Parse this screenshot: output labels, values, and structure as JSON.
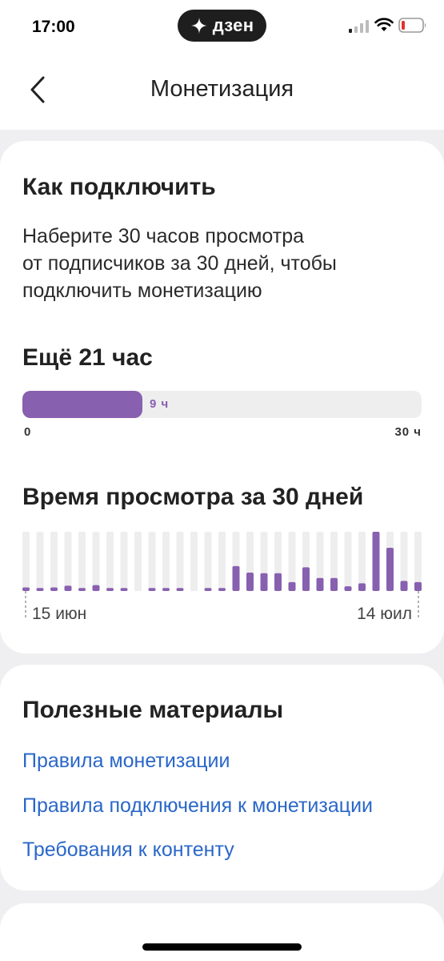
{
  "status_bar": {
    "time": "17:00",
    "brand": "дзен",
    "battery_color": "#e5332a"
  },
  "header": {
    "title": "Монетизация"
  },
  "connect": {
    "title": "Как подключить",
    "description_lines": [
      "Наберите 30 часов просмотра",
      "от подписчиков за 30 дней, чтобы",
      "подключить монетизацию"
    ]
  },
  "progress": {
    "title": "Ещё 21 час",
    "current_hours": 9,
    "max_hours": 30,
    "value_label": "9 ч",
    "min_label": "0",
    "max_label": "30 ч",
    "color": "#8860b0"
  },
  "chart_data": {
    "type": "bar",
    "title": "Время просмотра за 30 дней",
    "x_start_label": "15 июн",
    "x_end_label": "14 юил",
    "values": [
      0.06,
      0.05,
      0.06,
      0.09,
      0.05,
      0.1,
      0.05,
      0.05,
      0,
      0.05,
      0.05,
      0.05,
      0,
      0.05,
      0.05,
      0.42,
      0.31,
      0.3,
      0.3,
      0.15,
      0.4,
      0.22,
      0.22,
      0.08,
      0.13,
      1.0,
      0.73,
      0.17,
      0.15
    ],
    "bar_color": "#8860b0",
    "track_color": "#eeeeef"
  },
  "materials": {
    "title": "Полезные материалы",
    "links": [
      "Правила монетизации",
      "Правила подключения к монетизации",
      "Требования к контенту"
    ],
    "link_color": "#2a67c8"
  }
}
